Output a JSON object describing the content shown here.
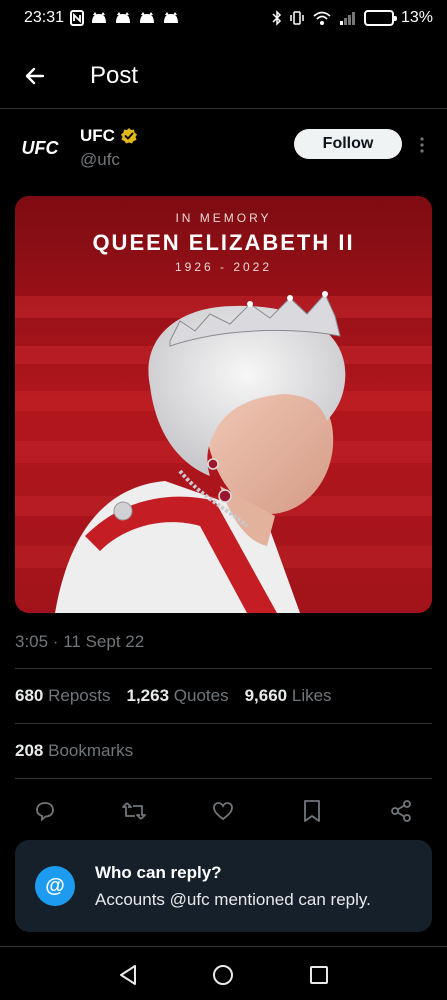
{
  "status_bar": {
    "time": "23:31",
    "battery_percent": "13%",
    "battery_level": 0.13,
    "battery_color": "#f5a623",
    "left_icons": [
      "nfc-icon",
      "cat-icon",
      "cat-icon",
      "cat-icon",
      "cat-icon"
    ],
    "right_icons": [
      "bluetooth-icon",
      "vibrate-icon",
      "wifi-icon",
      "signal-icon",
      "battery-icon"
    ]
  },
  "header": {
    "title": "Post",
    "back_icon": "back-arrow-icon"
  },
  "author": {
    "logo_text": "UFC",
    "name": "UFC",
    "verified_icon": "verified-gold-badge-icon",
    "handle": "@ufc",
    "follow_label": "Follow",
    "more_icon": "more-vertical-icon"
  },
  "post_image": {
    "line1": "IN MEMORY",
    "line2": "QUEEN ELIZABETH II",
    "line3": "1926 - 2022",
    "background_color": "#9a1219"
  },
  "post": {
    "timestamp": "3:05 · 11 Sept 22"
  },
  "stats": {
    "reposts_count": "680",
    "reposts_label": "Reposts",
    "quotes_count": "1,263",
    "quotes_label": "Quotes",
    "likes_count": "9,660",
    "likes_label": "Likes",
    "bookmarks_count": "208",
    "bookmarks_label": "Bookmarks"
  },
  "actions": [
    "reply-icon",
    "repost-icon",
    "like-icon",
    "bookmark-icon",
    "share-icon"
  ],
  "reply_notice": {
    "icon_text": "@",
    "title": "Who can reply?",
    "subtitle": "Accounts @ufc mentioned can reply."
  },
  "nav": [
    "back-triangle-icon",
    "home-circle-icon",
    "recents-square-icon"
  ],
  "colors": {
    "accent": "#1d9bf0",
    "verified_gold": "#e2b719",
    "muted_text": "#71767b"
  }
}
